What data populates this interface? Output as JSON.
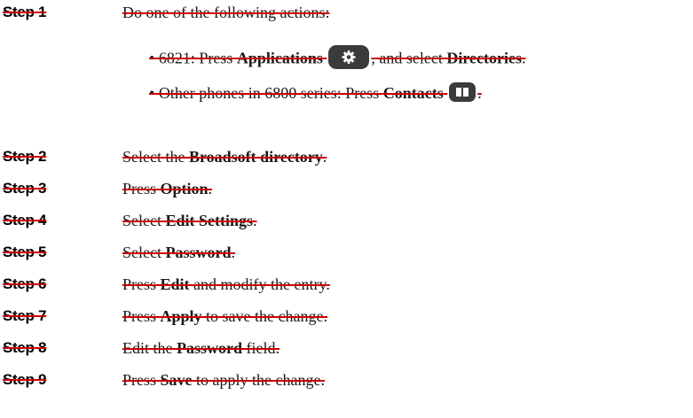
{
  "steps": [
    {
      "label": "Step 1",
      "text": "Do one of the following actions:"
    },
    {
      "label": "Step 2",
      "pre": "Select the ",
      "bold": "Broadsoft directory",
      "post": "."
    },
    {
      "label": "Step 3",
      "pre": "Press ",
      "bold": "Option",
      "post": "."
    },
    {
      "label": "Step 4",
      "pre": "Select ",
      "bold": "Edit Settings",
      "post": "."
    },
    {
      "label": "Step 5",
      "pre": "Select ",
      "bold": "Password",
      "post": "."
    },
    {
      "label": "Step 6",
      "pre": "Press ",
      "bold": "Edit",
      "post": " and modify the entry."
    },
    {
      "label": "Step 7",
      "pre": "Press ",
      "bold": "Apply",
      "post": " to save the change."
    },
    {
      "label": "Step 8",
      "pre": "Edit the ",
      "bold": "Password",
      "post": " field."
    },
    {
      "label": "Step 9",
      "pre": "Press ",
      "bold": "Save",
      "post": " to apply the change."
    }
  ],
  "substeps": [
    {
      "bullet": "•",
      "pre": " 6821: Press ",
      "bold": "Applications",
      "icon": "gear-icon",
      "mid": ", and select ",
      "bold2": "Directories",
      "post": "."
    },
    {
      "bullet": "•",
      "pre": " Other phones in 6800 series: Press ",
      "bold": "Contacts",
      "icon": "book-icon",
      "post": "."
    }
  ],
  "colors": {
    "strike": "#cc0000",
    "key_background": "#3b3b3b"
  }
}
